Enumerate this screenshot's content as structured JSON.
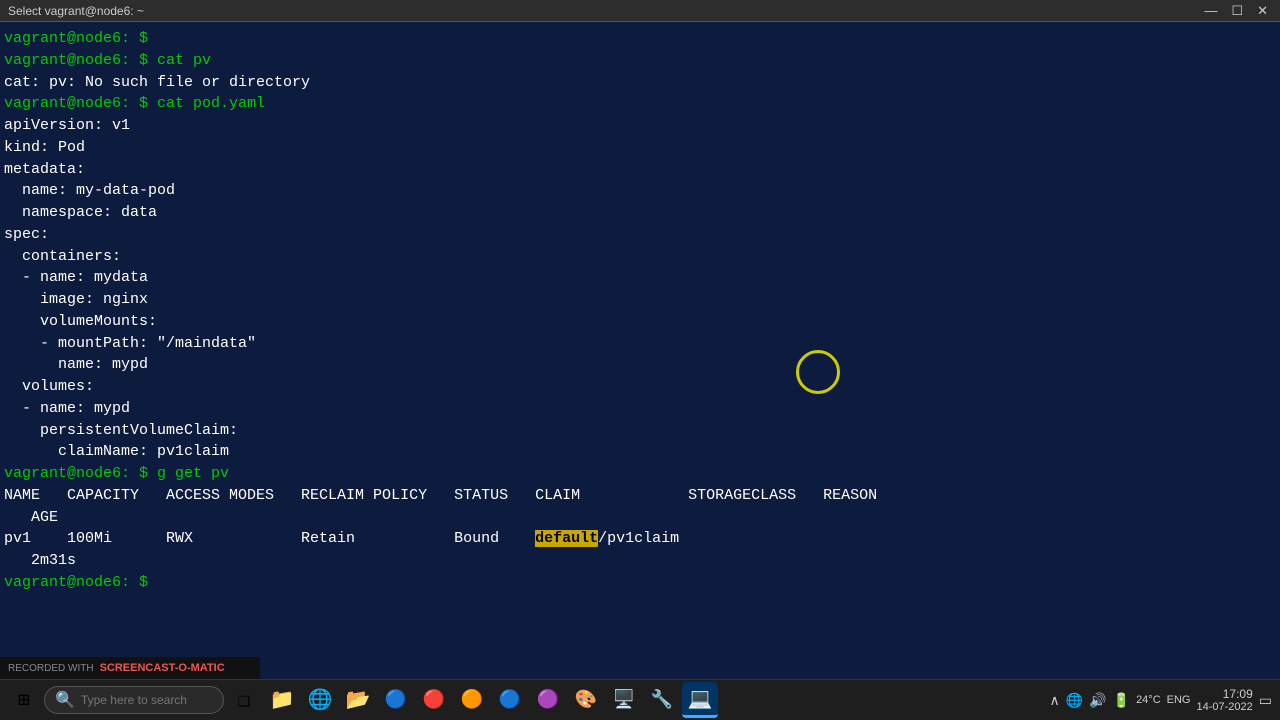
{
  "titlebar": {
    "title": "Select vagrant@node6: ~",
    "min": "—",
    "max": "☐",
    "close": "✕"
  },
  "terminal": {
    "lines": [
      {
        "id": "l1",
        "parts": [
          {
            "text": "vagrant@node6: $ ",
            "cls": "green"
          }
        ]
      },
      {
        "id": "l2",
        "parts": [
          {
            "text": "vagrant@node6: $ cat pv",
            "cls": "green"
          }
        ]
      },
      {
        "id": "l3",
        "parts": [
          {
            "text": "cat: pv: No such file or directory",
            "cls": "white"
          }
        ]
      },
      {
        "id": "l4",
        "parts": [
          {
            "text": "vagrant@node6: $ cat pod.yaml",
            "cls": "green"
          }
        ]
      },
      {
        "id": "l5",
        "parts": [
          {
            "text": "apiVersion: v1",
            "cls": "white"
          }
        ]
      },
      {
        "id": "l6",
        "parts": [
          {
            "text": "kind: Pod",
            "cls": "white"
          }
        ]
      },
      {
        "id": "l7",
        "parts": [
          {
            "text": "metadata:",
            "cls": "white"
          }
        ]
      },
      {
        "id": "l8",
        "parts": [
          {
            "text": "  name: my-data-pod",
            "cls": "white"
          }
        ]
      },
      {
        "id": "l9",
        "parts": [
          {
            "text": "  namespace: data",
            "cls": "white"
          }
        ]
      },
      {
        "id": "l10",
        "parts": [
          {
            "text": "spec:",
            "cls": "white"
          }
        ]
      },
      {
        "id": "l11",
        "parts": [
          {
            "text": "  containers:",
            "cls": "white"
          }
        ]
      },
      {
        "id": "l12",
        "parts": [
          {
            "text": "  - name: mydata",
            "cls": "white"
          }
        ]
      },
      {
        "id": "l13",
        "parts": [
          {
            "text": "    image: nginx",
            "cls": "white"
          }
        ]
      },
      {
        "id": "l14",
        "parts": [
          {
            "text": "    volumeMounts:",
            "cls": "white"
          }
        ]
      },
      {
        "id": "l15",
        "parts": [
          {
            "text": "    - mountPath: \"/maindata\"",
            "cls": "white"
          }
        ]
      },
      {
        "id": "l16",
        "parts": [
          {
            "text": "      name: mypd",
            "cls": "white"
          }
        ]
      },
      {
        "id": "l17",
        "parts": [
          {
            "text": "  volumes:",
            "cls": "white"
          }
        ]
      },
      {
        "id": "l18",
        "parts": [
          {
            "text": "  - name: mypd",
            "cls": "white"
          }
        ]
      },
      {
        "id": "l19",
        "parts": [
          {
            "text": "    persistentVolumeClaim:",
            "cls": "white"
          }
        ]
      },
      {
        "id": "l20",
        "parts": [
          {
            "text": "      claimName: pv1claim",
            "cls": "white"
          }
        ]
      },
      {
        "id": "l21",
        "parts": [
          {
            "text": "vagrant@node6: $ g get pv",
            "cls": "green"
          }
        ]
      },
      {
        "id": "l22",
        "parts": [
          {
            "text": "NAME   CAPACITY   ACCESS MODES   RECLAIM POLICY   STATUS   CLAIM            STORAGECLASS   REASON\n   AGE",
            "cls": "white"
          }
        ]
      },
      {
        "id": "l23",
        "parts": [
          {
            "text": "pv1    100Mi      RWX            Retain           Bound    ",
            "cls": "white"
          },
          {
            "text": "default",
            "cls": "yellow-hl"
          },
          {
            "text": "/pv1claim\n   2m31s",
            "cls": "white"
          }
        ]
      },
      {
        "id": "l24",
        "parts": [
          {
            "text": "vagrant@node6: $ ",
            "cls": "green"
          }
        ]
      }
    ]
  },
  "taskbar": {
    "search_placeholder": "Type here to search",
    "icons": [
      "⊞",
      "🔍",
      "📁",
      "🌐",
      "📂",
      "🔵",
      "🔴",
      "🟠",
      "🔵",
      "🟣",
      "🎨",
      "🖥️",
      "🔧"
    ],
    "clock_time": "17:09",
    "clock_date": "14-07-2022",
    "temp": "24°C",
    "lang": "ENG"
  },
  "screencast": {
    "label": "RECORDED WITH",
    "brand": "SCREENCAST-O-MATIC"
  }
}
